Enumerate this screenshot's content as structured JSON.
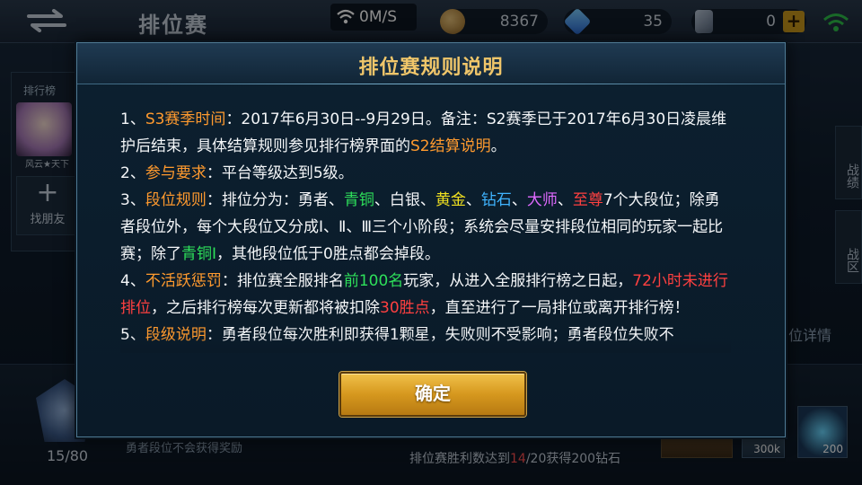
{
  "topbar": {
    "title": "排位赛",
    "network_speed": "0M/S",
    "gold": "8367",
    "diamonds": "35",
    "vouchers": "0",
    "icons": [
      "back-icon",
      "wifi-icon",
      "gold-coin-icon",
      "diamond-icon",
      "crystal-icon",
      "plus-icon",
      "signal-icon"
    ]
  },
  "left": {
    "tab_label": "排行榜",
    "avatar_name": "风云★天下",
    "add_friend_label": "找朋友",
    "add_icon": "+"
  },
  "right": {
    "tabs": [
      "战绩",
      "战区"
    ],
    "rank_detail": "位详情"
  },
  "bottom": {
    "progress": "15/80",
    "note": "勇者段位不会获得奖励",
    "win_note_prefix": "排位赛胜利数达到",
    "win_count": "14",
    "win_note_suffix": "/20获得200钻石",
    "reward1_value": "300k",
    "reward2_value": "200"
  },
  "modal": {
    "title": "排位赛规则说明",
    "p1": {
      "num": "1、",
      "label": "S3赛季时间",
      "text1": "：2017年6月30日--9月29日。备注：S2赛季已于2017年6月30日凌晨维护后结束，具体结算规则参见排行榜界面的",
      "link": "S2结算说明",
      "text2": "。"
    },
    "p2": {
      "num": "2、",
      "label": "参与要求",
      "text": "：平台等级达到5级。"
    },
    "p3": {
      "num": "3、",
      "label": "段位规则",
      "t1": "：排位分为：勇者、",
      "tier_bronze": "青铜",
      "t2": "、白银、",
      "tier_gold": "黄金",
      "t3": "、",
      "tier_diamond": "钻石",
      "t4": "、",
      "tier_master": "大师",
      "t5": "、",
      "tier_supreme": "至尊",
      "t6": "7个大段位；除勇者段位外，每个大段位又分成Ⅰ、Ⅱ、Ⅲ三个小阶段；系统会尽量安排段位相同的玩家一起比赛；除了",
      "tier_bronze1": "青铜Ⅰ",
      "t7": "，其他段位低于0胜点都会掉段。"
    },
    "p4": {
      "num": "4、",
      "label": "不活跃惩罚",
      "t1": "：排位赛全服排名",
      "top": "前100名",
      "t2": "玩家，从进入全服排行榜之日起，",
      "hours": "72小时未进行排位",
      "t3": "，之后排行榜每次更新都将被扣除",
      "points": "30胜点",
      "t4": "，直至进行了一局排位或离开排行榜！"
    },
    "p5": {
      "num": "5、",
      "label": "段级说明",
      "text": "：勇者段位每次胜利即获得1颗星，失败则不受影响；勇者段位失败不"
    },
    "confirm": "确定"
  },
  "colors": {
    "title_gold": "#f0c66a",
    "label_orange": "#ff9a2e",
    "bronze_green": "#2ee05a",
    "gold_yellow": "#f0e020",
    "diamond_blue": "#3fb4ff",
    "master_purple": "#e06aff",
    "supreme_red": "#ff4040"
  }
}
